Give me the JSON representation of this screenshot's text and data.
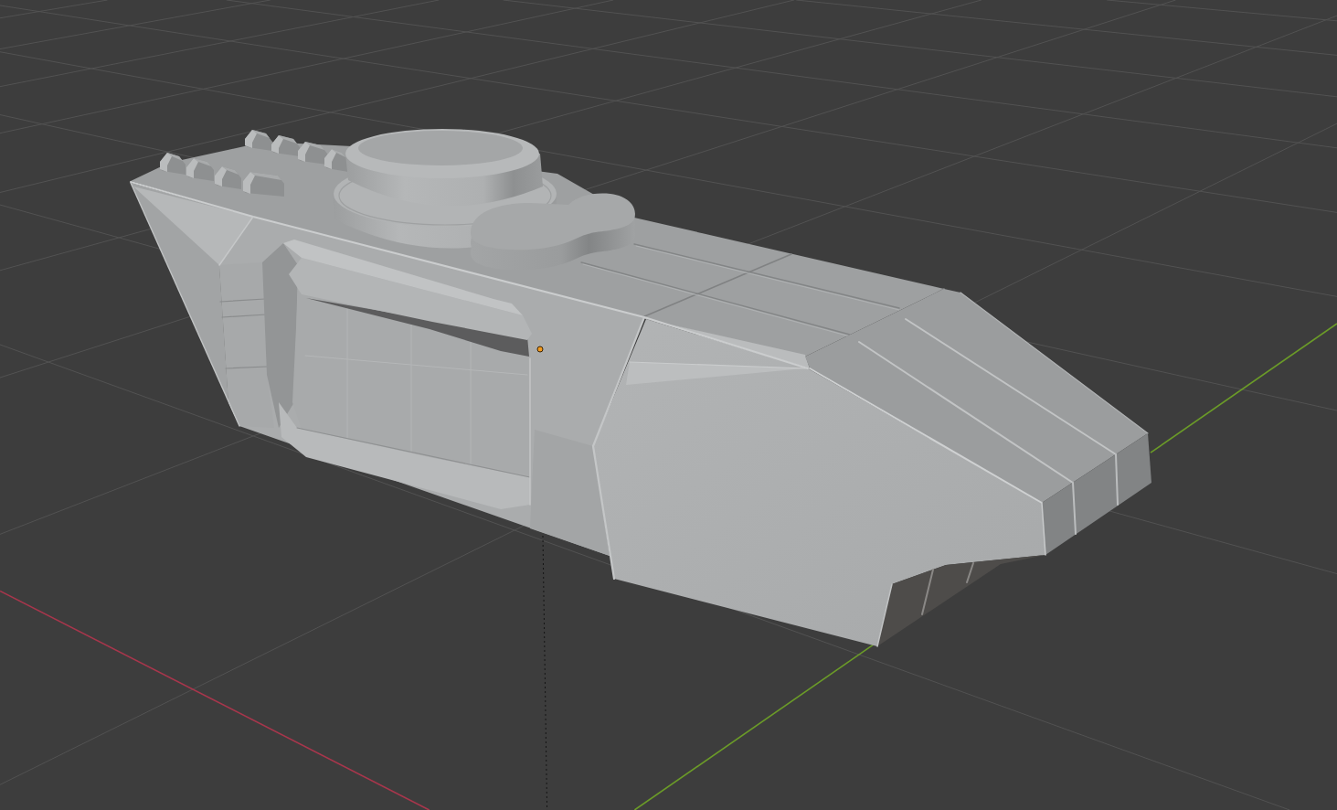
{
  "viewport": {
    "floor_grid": {
      "axes": [
        {
          "color": "#a8364c"
        },
        {
          "color": "#6b9b28"
        }
      ]
    }
  }
}
